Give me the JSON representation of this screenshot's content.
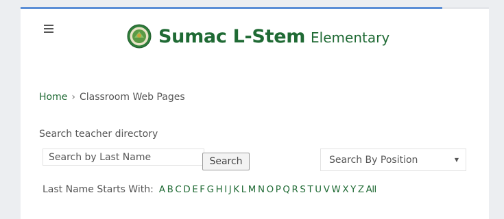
{
  "header": {
    "brand_name": "Sumac L-Stem",
    "brand_subtitle": "Elementary"
  },
  "breadcrumb": {
    "home": "Home",
    "separator": "›",
    "current": "Classroom Web Pages"
  },
  "search": {
    "label": "Search teacher directory",
    "placeholder": "Search by Last Name",
    "button_label": "Search",
    "position_select": "Search By Position"
  },
  "alphabet": {
    "label": "Last Name Starts With:",
    "letters": [
      "A",
      "B",
      "C",
      "D",
      "E",
      "F",
      "G",
      "H",
      "I",
      "J",
      "K",
      "L",
      "M",
      "N",
      "O",
      "P",
      "Q",
      "R",
      "S",
      "T",
      "U",
      "V",
      "W",
      "X",
      "Y",
      "Z",
      "All"
    ]
  },
  "colors": {
    "brand_green": "#1f6a34",
    "progress_blue": "#5b8ed6"
  }
}
